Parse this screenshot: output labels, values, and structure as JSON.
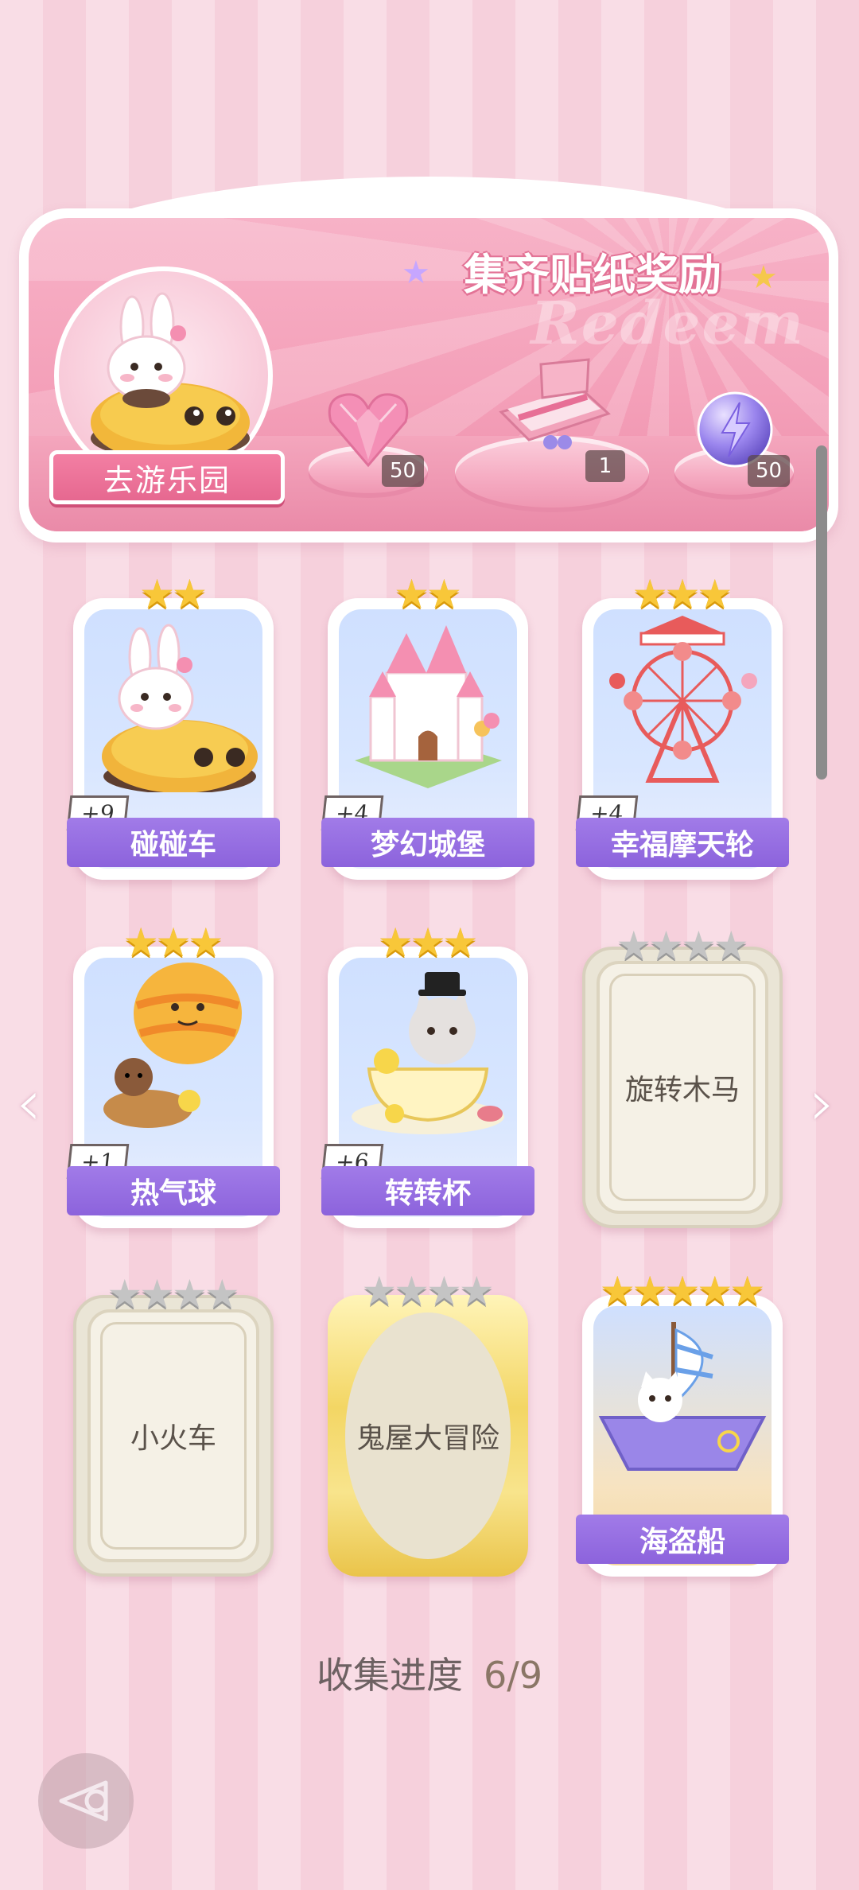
{
  "banner": {
    "title": "集齐贴纸奖励",
    "watermark": "Redeem",
    "park_button": "去游乐园",
    "rewards": [
      {
        "icon": "pink-diamond-heart-icon",
        "count": "50"
      },
      {
        "icon": "gift-box-icon",
        "count": "1"
      },
      {
        "icon": "energy-orb-icon",
        "count": "50"
      }
    ]
  },
  "cards": [
    {
      "name": "碰碰车",
      "badge": "+9",
      "stars": 2,
      "max_stars": 2,
      "collected": true
    },
    {
      "name": "梦幻城堡",
      "badge": "+4",
      "stars": 2,
      "max_stars": 2,
      "collected": true
    },
    {
      "name": "幸福摩天轮",
      "badge": "+4",
      "stars": 3,
      "max_stars": 3,
      "collected": true
    },
    {
      "name": "热气球",
      "badge": "+1",
      "stars": 3,
      "max_stars": 3,
      "collected": true
    },
    {
      "name": "转转杯",
      "badge": "+6",
      "stars": 3,
      "max_stars": 3,
      "collected": true
    },
    {
      "name": "旋转木马",
      "stars": 0,
      "max_stars": 4,
      "collected": false
    },
    {
      "name": "小火车",
      "stars": 0,
      "max_stars": 4,
      "collected": false
    },
    {
      "name": "鬼屋大冒险",
      "stars": 0,
      "max_stars": 4,
      "collected": false
    },
    {
      "name": "海盗船",
      "stars": 5,
      "max_stars": 5,
      "collected": true
    }
  ],
  "progress": {
    "label": "收集进度",
    "value": "6/9"
  },
  "nav": {
    "prev": "‹",
    "next": "›"
  },
  "colors": {
    "accent_purple": "#9a72e4",
    "accent_pink": "#f37fa3",
    "star_gold": "#f8c739"
  }
}
